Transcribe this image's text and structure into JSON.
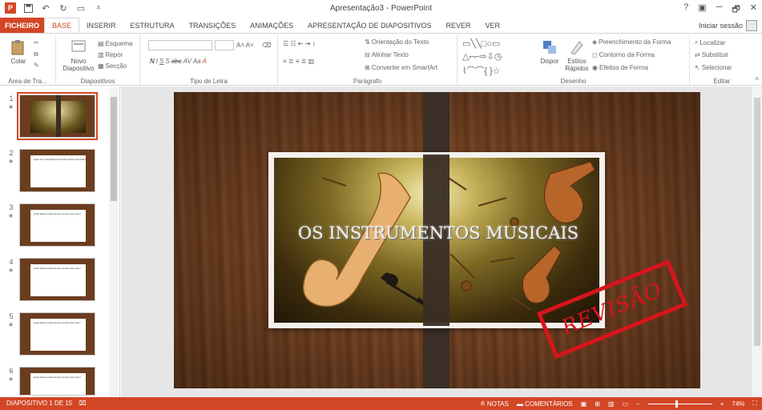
{
  "window": {
    "title": "Apresentação3 - PowerPoint",
    "help": "?",
    "controls": [
      "─",
      "🗗",
      "✕"
    ]
  },
  "tabs": [
    "FICHEIRO",
    "BASE",
    "INSERIR",
    "ESTRUTURA",
    "TRANSIÇÕES",
    "ANIMAÇÕES",
    "APRESENTAÇÃO DE DIAPOSITIVOS",
    "REVER",
    "VER"
  ],
  "active_tab": "BASE",
  "signin": "Iniciar sessão",
  "ribbon": {
    "clipboard": {
      "label": "Área de Tra...",
      "paste": "Colar"
    },
    "slides": {
      "label": "Diapositivos",
      "new_slide": "Novo",
      "new_slide2": "Diapositivo",
      "layout": "Esquema",
      "reset": "Repor",
      "section": "Secção"
    },
    "font": {
      "label": "Tipo de Letra",
      "bold": "N",
      "italic": "I",
      "underline": "S",
      "shadow": "S",
      "strike": "abc",
      "aa": "Aa"
    },
    "paragraph": {
      "label": "Parágrafo",
      "text_dir": "Orientação do Texto",
      "align_text": "Alinhar Texto",
      "smartart": "Converter em SmartArt"
    },
    "drawing": {
      "label": "Desenho",
      "arrange": "Dispor",
      "quick_styles": "Estilos",
      "quick_styles2": "Rápidos",
      "fill": "Preenchimento da Forma",
      "outline": "Contorno da Forma",
      "effects": "Efeitos de Forma"
    },
    "editing": {
      "label": "Editar",
      "find": "Localizar",
      "replace": "Substituir",
      "select": "Selecionar"
    }
  },
  "thumbnails": [
    {
      "num": "1",
      "text": ""
    },
    {
      "num": "2",
      "text": "Quer ver a fotografia dos instrumentos musicais?"
    },
    {
      "num": "3",
      "text": "Qual destes instrumentos produz este som?"
    },
    {
      "num": "4",
      "text": "Qual destes instrumentos produz este som?"
    },
    {
      "num": "5",
      "text": "Qual destes instrumentos produz este som?"
    },
    {
      "num": "6",
      "text": "Qual destes instrumentos produz este som?"
    }
  ],
  "slide": {
    "title": "OS INSTRUMENTOS MUSICAIS",
    "stamp": "REVISÃO"
  },
  "status": {
    "slide_counter": "DIAPOSITIVO 1 DE 15",
    "notes": "NOTAS",
    "comments": "COMENTÁRIOS",
    "zoom": "74%",
    "zoom_level": 0.74
  },
  "colors": {
    "accent": "#d24726",
    "stamp": "#d8141c"
  }
}
